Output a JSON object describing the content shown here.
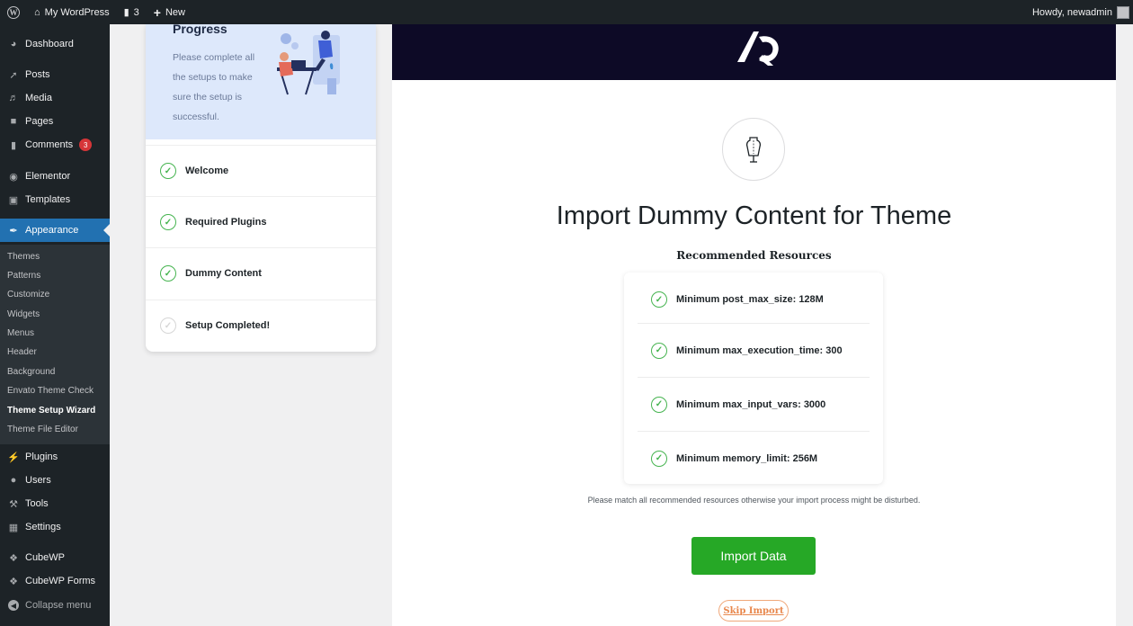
{
  "adminbar": {
    "site_name": "My WordPress",
    "comments_count": "3",
    "new_label": "New",
    "howdy": "Howdy, newadmin"
  },
  "sidebar": {
    "items": [
      {
        "label": "Dashboard",
        "icon": "dashboard-icon"
      },
      {
        "label": "Posts",
        "icon": "pin-icon"
      },
      {
        "label": "Media",
        "icon": "media-icon"
      },
      {
        "label": "Pages",
        "icon": "page-icon"
      },
      {
        "label": "Comments",
        "icon": "comment-icon",
        "badge": "3"
      },
      {
        "label": "Elementor",
        "icon": "elementor-icon"
      },
      {
        "label": "Templates",
        "icon": "folder-icon"
      },
      {
        "label": "Appearance",
        "icon": "brush-icon"
      },
      {
        "label": "Plugins",
        "icon": "plug-icon"
      },
      {
        "label": "Users",
        "icon": "user-icon"
      },
      {
        "label": "Tools",
        "icon": "wrench-icon"
      },
      {
        "label": "Settings",
        "icon": "settings-icon"
      },
      {
        "label": "CubeWP",
        "icon": "cube-icon"
      },
      {
        "label": "CubeWP Forms",
        "icon": "cube-icon"
      },
      {
        "label": "Collapse menu",
        "icon": "collapse-icon"
      }
    ],
    "submenu": [
      "Themes",
      "Patterns",
      "Customize",
      "Widgets",
      "Menus",
      "Header",
      "Background",
      "Envato Theme Check",
      "Theme Setup Wizard",
      "Theme File Editor"
    ]
  },
  "progress": {
    "title": "Progress",
    "description": "Please complete all the setups to make sure the setup is successful.",
    "steps": [
      {
        "label": "Welcome",
        "done": true
      },
      {
        "label": "Required Plugins",
        "done": true
      },
      {
        "label": "Dummy Content",
        "done": true
      },
      {
        "label": "Setup Completed!",
        "done": false
      }
    ]
  },
  "main": {
    "title": "Import Dummy Content for Theme",
    "recommended_title": "Recommended Resources",
    "requirements": [
      "Minimum post_max_size: 128M",
      "Minimum max_execution_time: 300",
      "Minimum max_input_vars: 3000",
      "Minimum memory_limit: 256M"
    ],
    "note": "Please match all recommended resources otherwise your import process might be disturbed.",
    "import_button": "Import Data",
    "skip_button": "Skip Import"
  },
  "colors": {
    "admin_dark": "#1d2327",
    "active_blue": "#2271b1",
    "success_green": "#46b450",
    "import_green": "#26a826",
    "skip_orange": "#e8874c",
    "hero_dark": "#0d0a26"
  }
}
